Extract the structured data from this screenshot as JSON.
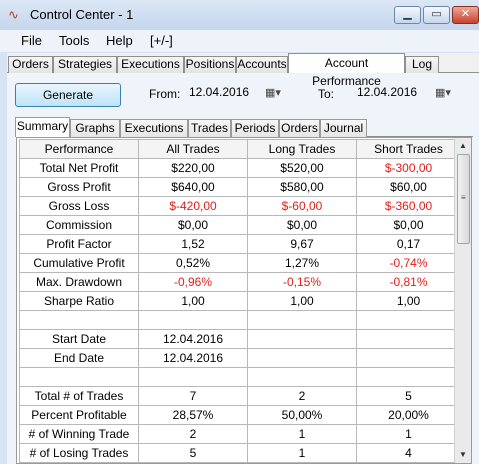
{
  "window": {
    "title": "Control Center - 1"
  },
  "menu": [
    "File",
    "Tools",
    "Help",
    "[+/-]"
  ],
  "main_tabs": [
    "Orders",
    "Strategies",
    "Executions",
    "Positions",
    "Accounts",
    "Account Performance",
    "Log"
  ],
  "toolbar": {
    "generate_label": "Generate",
    "from_label": "From:",
    "from_date": "12.04.2016",
    "to_label": "To:",
    "to_date": "12.04.2016"
  },
  "sub_tabs": [
    "Summary",
    "Graphs",
    "Executions",
    "Trades",
    "Periods",
    "Orders",
    "Journal"
  ],
  "grid": {
    "columns": [
      "Performance",
      "All Trades",
      "Long Trades",
      "Short Trades"
    ],
    "rows": [
      [
        "Total Net Profit",
        "$220,00",
        "$520,00",
        "$-300,00"
      ],
      [
        "Gross Profit",
        "$640,00",
        "$580,00",
        "$60,00"
      ],
      [
        "Gross Loss",
        "$-420,00",
        "$-60,00",
        "$-360,00"
      ],
      [
        "Commission",
        "$0,00",
        "$0,00",
        "$0,00"
      ],
      [
        "Profit Factor",
        "1,52",
        "9,67",
        "0,17"
      ],
      [
        "Cumulative Profit",
        "0,52%",
        "1,27%",
        "-0,74%"
      ],
      [
        "Max. Drawdown",
        "-0,96%",
        "-0,15%",
        "-0,81%"
      ],
      [
        "Sharpe Ratio",
        "1,00",
        "1,00",
        "1,00"
      ],
      [
        "",
        "",
        "",
        ""
      ],
      [
        "Start Date",
        "12.04.2016",
        "",
        ""
      ],
      [
        "End Date",
        "12.04.2016",
        "",
        ""
      ],
      [
        "",
        "",
        "",
        ""
      ],
      [
        "Total # of Trades",
        "7",
        "2",
        "5"
      ],
      [
        "Percent Profitable",
        "28,57%",
        "50,00%",
        "20,00%"
      ],
      [
        "# of Winning Trade",
        "2",
        "1",
        "1"
      ],
      [
        "# of Losing Trades",
        "5",
        "1",
        "4"
      ]
    ]
  },
  "colors": {
    "negative": "#e0201b"
  }
}
